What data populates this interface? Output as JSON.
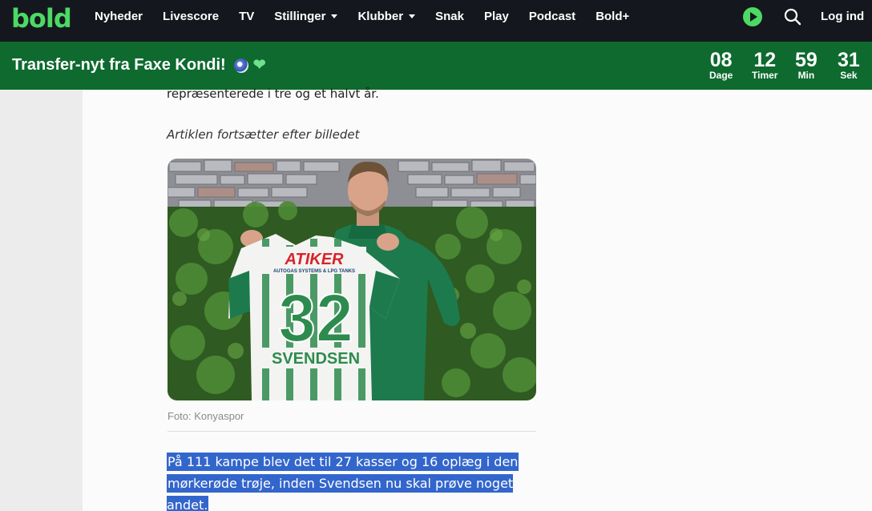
{
  "brand": {
    "logo_text": "bold",
    "accent": "#4cd964",
    "nav_bg": "#14181e",
    "banner_bg": "#0e6a2e"
  },
  "nav": {
    "items": [
      {
        "label": "Nyheder",
        "dropdown": false
      },
      {
        "label": "Livescore",
        "dropdown": false
      },
      {
        "label": "TV",
        "dropdown": false
      },
      {
        "label": "Stillinger",
        "dropdown": true
      },
      {
        "label": "Klubber",
        "dropdown": true
      },
      {
        "label": "Snak",
        "dropdown": false
      },
      {
        "label": "Play",
        "dropdown": false
      },
      {
        "label": "Podcast",
        "dropdown": false
      },
      {
        "label": "Bold+",
        "dropdown": false
      }
    ],
    "icons": {
      "play": "play-icon",
      "search": "search-icon"
    },
    "login_label": "Log ind"
  },
  "banner": {
    "title": "Transfer-nyt fra Faxe Kondi!",
    "countdown": [
      {
        "value": "08",
        "label": "Dage"
      },
      {
        "value": "12",
        "label": "Timer"
      },
      {
        "value": "59",
        "label": "Min"
      },
      {
        "value": "31",
        "label": "Sek"
      }
    ]
  },
  "article": {
    "para_top": "repræsenterede i tre og et halvt år.",
    "continues": "Artiklen fortsætter efter billedet",
    "photo": {
      "shirt_sponsor": "ATIKER",
      "shirt_sponsor_sub": "AUTOGAS SYSTEMS & LPG TANKS",
      "shirt_number": "32",
      "shirt_name": "SVENDSEN"
    },
    "caption": "Foto: Konyaspor",
    "para_bottom_line1": "På 111 kampe blev det til 27 kasser og 16 oplæg i den",
    "para_bottom_line2": "mørkerøde trøje, inden Svendsen nu skal prøve noget andet.",
    "selection_color": "#3366cc"
  }
}
